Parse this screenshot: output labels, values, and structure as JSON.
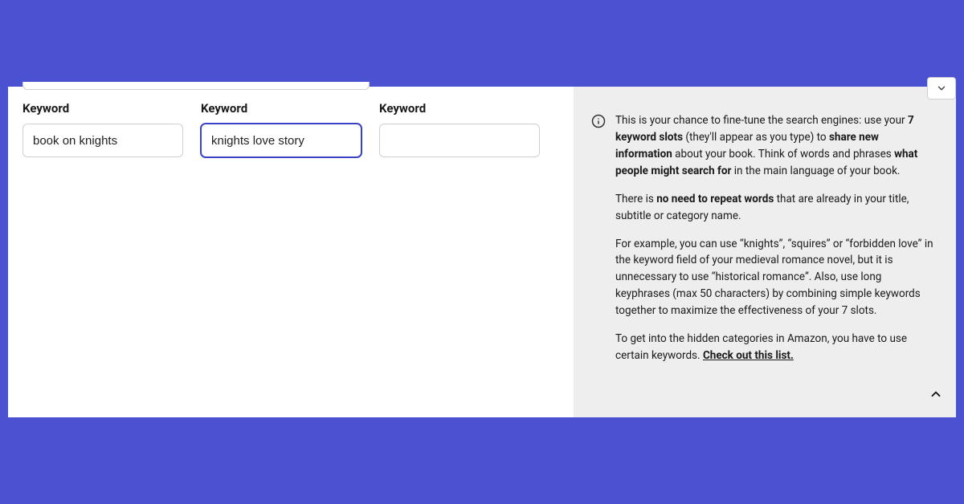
{
  "keywords": {
    "label": "Keyword",
    "field1_value": "book on knights",
    "field2_value": "knights love story",
    "field3_value": ""
  },
  "help": {
    "p1_lead": "This is your chance to fine-tune the search engines: use your ",
    "p1_bold1": "7 keyword slots",
    "p1_mid1": " (they'll appear as you type) to ",
    "p1_bold2": "share new information",
    "p1_mid2": " about your book. Think of words and phrases ",
    "p1_bold3": "what people might search for",
    "p1_tail": " in the main language of your book.",
    "p2_lead": "There is ",
    "p2_bold": "no need to repeat words",
    "p2_tail": " that are already in your title, subtitle or category name.",
    "p3": "For example, you can use “knights”, “squires” or “forbidden love” in the keyword field of your medieval romance novel, but it is unnecessary to use “historical romance”. Also, use long keyphrases (max 50 characters) by combining simple keywords together to maximize the effectiveness of your 7 slots.",
    "p4_lead": "To get into the hidden categories in Amazon, you have to use certain keywords. ",
    "p4_link": "Check out this list."
  }
}
